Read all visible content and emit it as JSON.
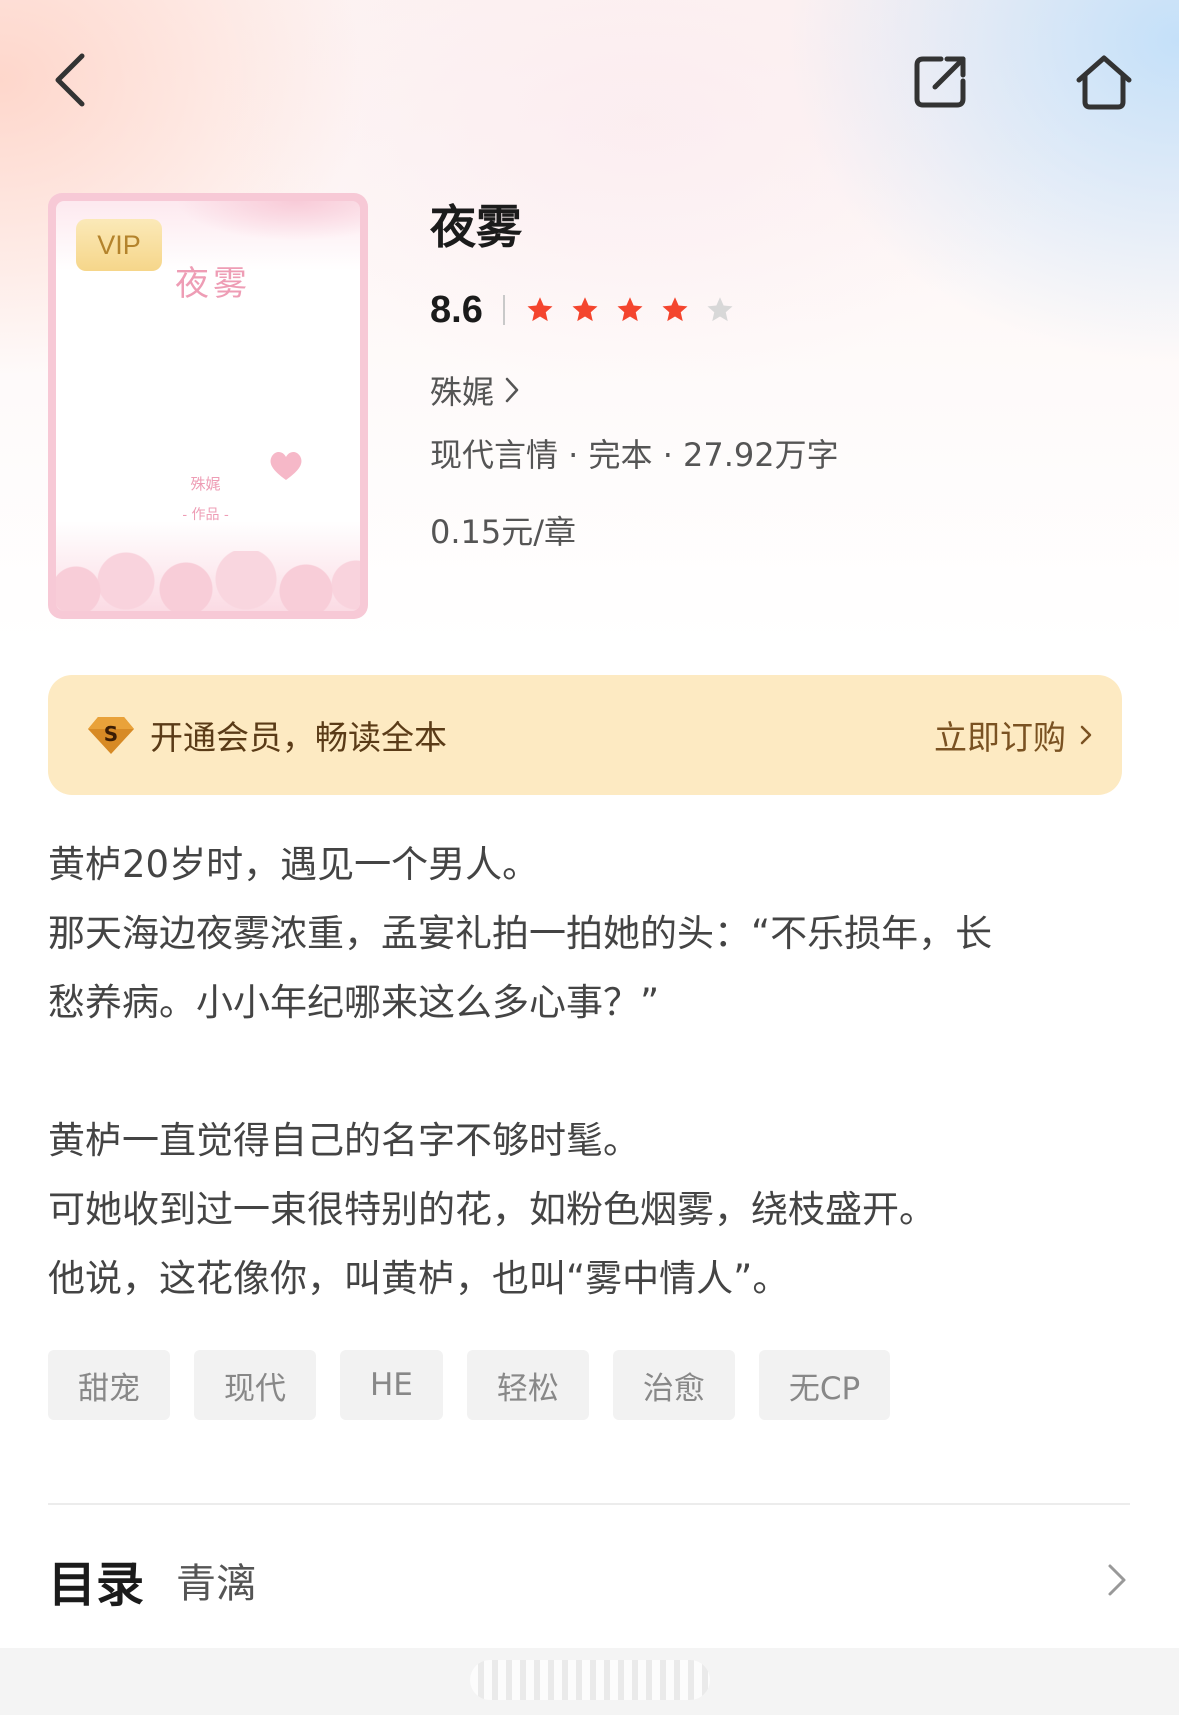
{
  "nav": {
    "back_icon": "chevron-left-icon",
    "share_icon": "share-external-icon",
    "home_icon": "home-icon"
  },
  "book": {
    "title": "夜雾",
    "score": "8.6",
    "stars_filled": 4,
    "stars_total": 5,
    "author": "殊娓",
    "meta": "现代言情 · 完本 · 27.92万字",
    "price": "0.15元/章"
  },
  "cover": {
    "badge": "VIP",
    "title": "夜雾",
    "author": "殊娓",
    "works_label": "- 作品 -"
  },
  "vip_banner": {
    "text": "开通会员，畅读全本",
    "action": "立即订购",
    "icon": "vip-diamond-icon"
  },
  "description": {
    "paragraphs": [
      "黄栌20岁时，遇见一个男人。",
      "那天海边夜雾浓重，孟宴礼拍一拍她的头：“不乐损年，长",
      "愁养病。小小年纪哪来这么多心事？”",
      "",
      "黄栌一直觉得自己的名字不够时髦。",
      "可她收到过一束很特别的花，如粉色烟雾，绕枝盛开。",
      "他说，这花像你，叫黄栌，也叫“雾中情人”。"
    ]
  },
  "tags": [
    "甜宠",
    "现代",
    "HE",
    "轻松",
    "治愈",
    "无CP"
  ],
  "toc": {
    "title": "目录",
    "subtitle": "青漓"
  },
  "colors": {
    "star_filled": "#f4452e",
    "star_empty": "#d8d8d8",
    "banner_bg": "#fdeac2",
    "cover_border": "#f7c9d6"
  }
}
